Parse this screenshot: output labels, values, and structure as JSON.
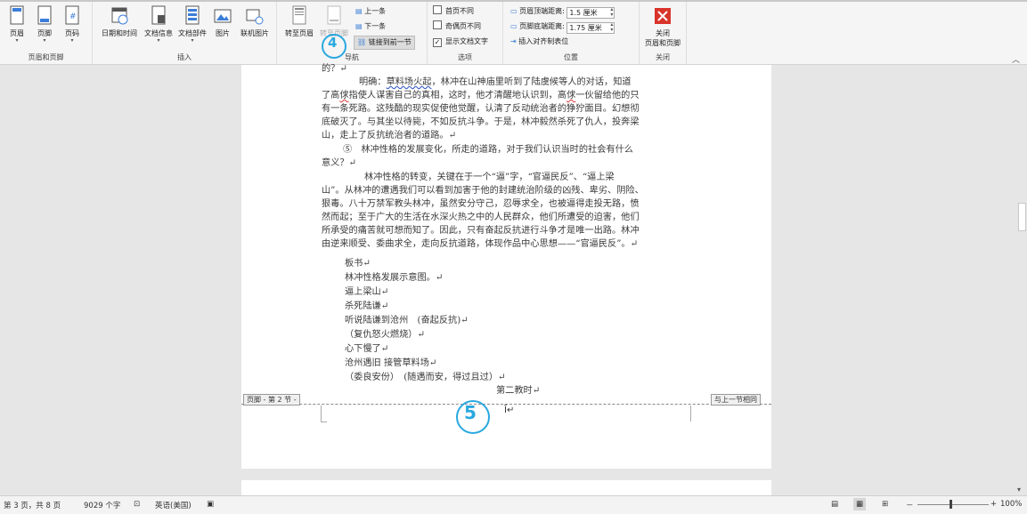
{
  "ribbon": {
    "groups": [
      {
        "label": "页眉和页脚"
      },
      {
        "label": "插入"
      },
      {
        "label": "导航"
      },
      {
        "label": "选项"
      },
      {
        "label": "位置"
      },
      {
        "label": "关闭"
      }
    ],
    "header_btn": "页眉",
    "footer_btn": "页脚",
    "page_num_btn": "页码",
    "datetime_btn": "日期和时间",
    "docinfo_btn": "文档信息",
    "docparts_btn": "文档部件",
    "picture_btn": "图片",
    "online_pic_btn": "联机图片",
    "goto_header_btn": "转至页眉",
    "goto_footer_btn": "转至页脚",
    "prev_btn": "上一条",
    "next_btn": "下一条",
    "link_prev_btn": "链接到前一节",
    "opt_first_page": "首页不同",
    "opt_odd_even": "奇偶页不同",
    "opt_show_text": "显示文档文字",
    "header_top_label": "页眉顶端距离:",
    "header_top_value": "1.5 厘米",
    "footer_bottom_label": "页脚底端距离:",
    "footer_bottom_value": "1.75 厘米",
    "insert_align_tab": "插入对齐制表位",
    "close_btn_line1": "关闭",
    "close_btn_line2": "页眉和页脚"
  },
  "document": {
    "line0": "的？↵",
    "p1_a": "明确：",
    "p1_b": "草料场火起",
    "p1_c": "，林冲在山神庙里听到了陆虞候等人的对话，知道",
    "p1_l2a": "了高",
    "p1_l2b": "俅",
    "p1_l2c": "指使人谋害自己的真相，这时，他才清醒地认识到，高",
    "p1_l2d": "俅",
    "p1_l2e": "一伙留给他的只",
    "p1_l3": "有一条死路。这残酷的现实促使他觉醒，认清了反动统治者的狰狞面目。幻想彻",
    "p1_l4": "底破灭了。与其坐以待毙，不如反抗斗争。于是，林冲毅然杀死了仇人，投奔梁",
    "p1_l5": "山，走上了反抗统治者的道路。↵",
    "q5_l1": "⑤　林冲性格的发展变化，所走的道路，对于我们认识当时的社会有什么",
    "q5_l2": "意义？↵",
    "p2_l1": "林冲性格的转变，关键在于一个“逼”字，“官逼民反”、“逼上梁",
    "p2_l2": "山”。从林冲的遭遇我们可以看到加害于他的封建统治阶级的凶残、卑劣、阴险、",
    "p2_l3": "狠毒。八十万禁军教头林冲，虽然安分守己，忍辱求全，也被逼得走投无路，愤",
    "p2_l4": "然而起；至于广大的生活在水深火热之中的人民群众，他们所遭受的迫害，他们",
    "p2_l5": "所承受的痛苦就可想而知了。因此，只有奋起反抗进行斗争才是唯一出路。林冲",
    "p2_l6": "由逆来顺受、委曲求全，走向反抗道路，体现作品中心思想——“官逼民反”。↵",
    "b1": "板书↵",
    "b2": "林冲性格发展示意图。↵",
    "b3": "逼上梁山↵",
    "b4": "杀死陆谦↵",
    "b5": "听说陆谦到沧州　(奋起反抗)↵",
    "b6": "（复仇怒火燃烧）↵",
    "b7": "心下慢了↵",
    "b8": "沧州遇旧  接管草料场↵",
    "b9": "（委良安份）　(随遇而安，得过且过）↵",
    "b10": "第二教时↵",
    "footer_tag_left": "页脚 - 第 2 节 -",
    "footer_tag_right": "与上一节相同"
  },
  "annotations": {
    "a4": "4",
    "a5": "5"
  },
  "status": {
    "page": "第 3 页，共 8 页",
    "words": "9029 个字",
    "lang": "英语(美国)",
    "zoom": "100%",
    "minus": "－",
    "plus": "+"
  }
}
